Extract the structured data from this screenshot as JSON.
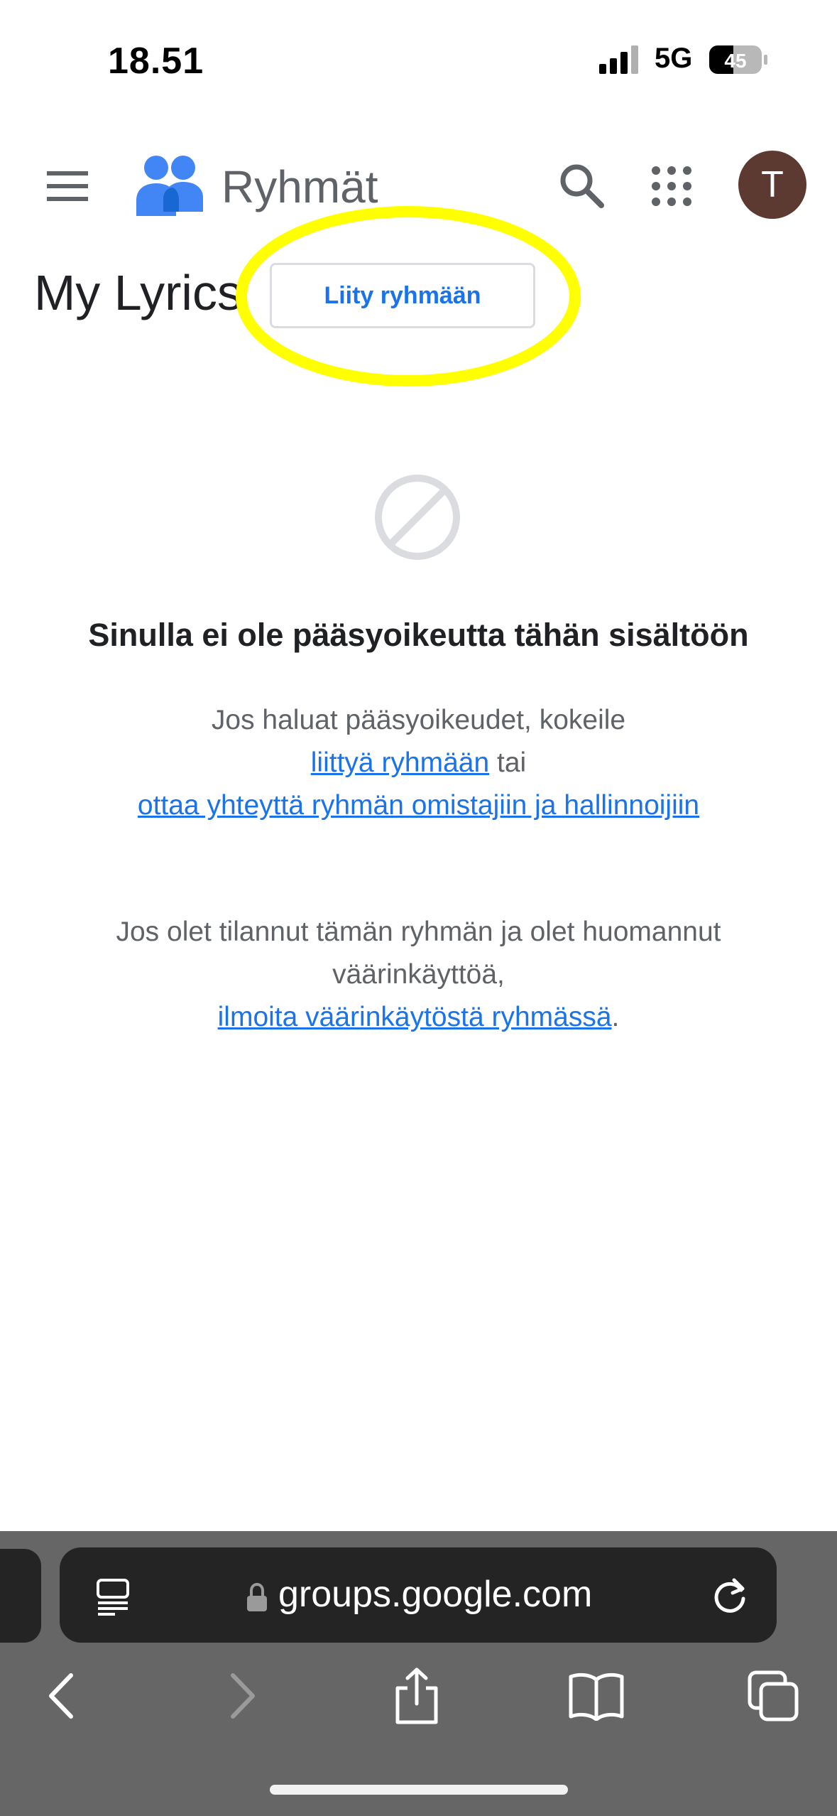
{
  "status_bar": {
    "time": "18.51",
    "network": "5G",
    "battery": "45"
  },
  "header": {
    "app_title": "Ryhmät",
    "avatar_initial": "T"
  },
  "group": {
    "name": "My Lyrics",
    "join_button": "Liity ryhmään"
  },
  "content": {
    "title": "Sinulla ei ole pääsyoikeutta tähän sisältöön",
    "para1_text": "Jos haluat pääsyoikeudet, kokeile",
    "join_link": "liittyä ryhmään",
    "or_text": "tai",
    "contact_link": "ottaa yhteyttä ryhmän omistajiin ja hallinnoijiin",
    "para2_text": "Jos olet tilannut tämän ryhmän ja olet huomannut väärinkäyttöä,",
    "report_link": "ilmoita väärinkäytöstä ryhmässä",
    "para2_end": "."
  },
  "browser": {
    "url": "groups.google.com"
  },
  "colors": {
    "accent": "#1a73e8",
    "highlight": "#ffff00",
    "avatar": "#5d3a31",
    "toolbar": "#666666"
  },
  "icons": [
    "menu-icon",
    "groups-logo-icon",
    "search-icon",
    "apps-grid-icon",
    "blocked-icon",
    "reader-icon",
    "lock-icon",
    "reload-icon",
    "back-icon",
    "forward-icon",
    "share-icon",
    "bookmarks-icon",
    "tabs-icon"
  ]
}
